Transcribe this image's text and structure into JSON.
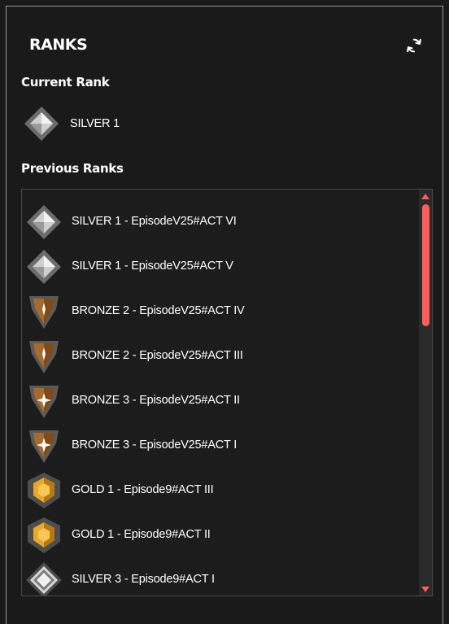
{
  "app": {
    "logo_text": "RANKS",
    "refresh_icon": "refresh-icon"
  },
  "current": {
    "title": "Current Rank",
    "rank": {
      "label": "SILVER 1",
      "tier": "silver",
      "icon": "silver-rank-icon"
    }
  },
  "previous": {
    "title": "Previous Ranks",
    "items": [
      {
        "label": "SILVER 1 - EpisodeV25#ACT VI",
        "tier": "silver"
      },
      {
        "label": "SILVER 1 - EpisodeV25#ACT V",
        "tier": "silver"
      },
      {
        "label": "BRONZE 2 - EpisodeV25#ACT IV",
        "tier": "bronze"
      },
      {
        "label": "BRONZE 2 - EpisodeV25#ACT III",
        "tier": "bronze"
      },
      {
        "label": "BRONZE 3 - EpisodeV25#ACT II",
        "tier": "bronze"
      },
      {
        "label": "BRONZE 3 - EpisodeV25#ACT I",
        "tier": "bronze"
      },
      {
        "label": "GOLD 1 - Episode9#ACT III",
        "tier": "gold"
      },
      {
        "label": "GOLD 1 - Episode9#ACT II",
        "tier": "gold"
      },
      {
        "label": "SILVER 3 - Episode9#ACT I",
        "tier": "silver3"
      }
    ]
  },
  "colors": {
    "accent": "#ff5c5c",
    "background": "#1a1a1a",
    "silver": "#b8b8b8",
    "bronze": "#a56b2c",
    "gold": "#e8a928"
  }
}
